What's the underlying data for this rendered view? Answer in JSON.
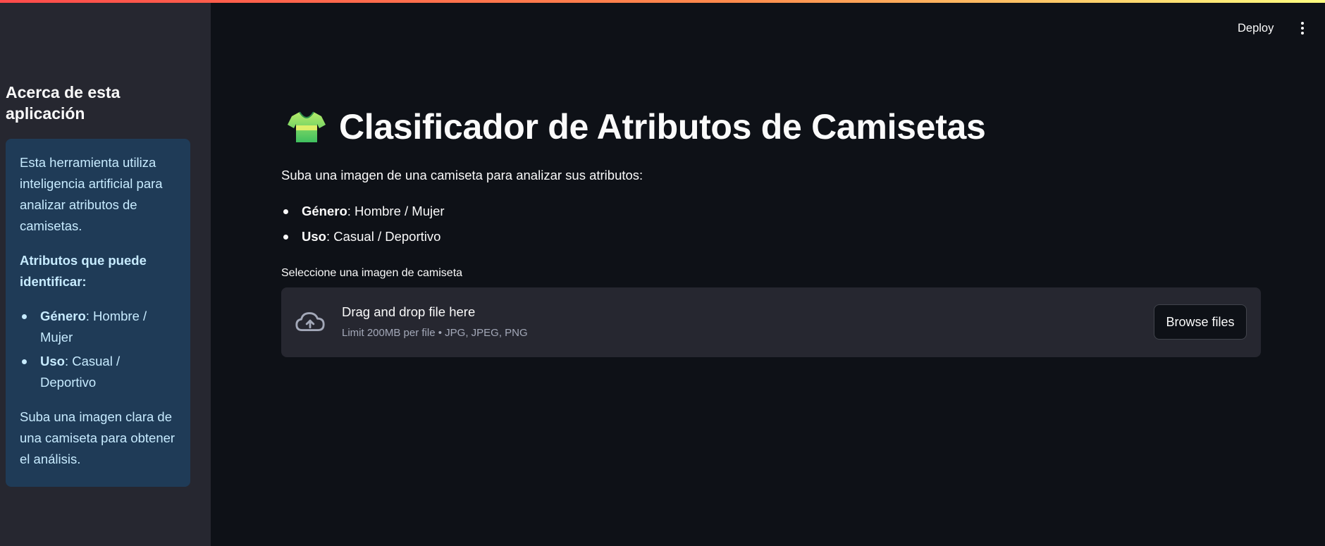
{
  "header": {
    "deploy_label": "Deploy",
    "menu_icon": "vertical-ellipsis-icon"
  },
  "sidebar": {
    "heading": "Acerca de esta aplicación",
    "info": {
      "intro": "Esta herramienta utiliza inteligencia artificial para analizar atributos de camisetas.",
      "attributes_heading": "Atributos que puede identificar:",
      "items": [
        {
          "term": "Género",
          "value": ": Hombre / Mujer"
        },
        {
          "term": "Uso",
          "value": ": Casual / Deportivo"
        }
      ],
      "footer": "Suba una imagen clara de una camiseta para obtener el análisis."
    }
  },
  "main": {
    "title_icon": "t-shirt-icon",
    "title": "Clasificador de Atributos de Camisetas",
    "intro": "Suba una imagen de una camiseta para analizar sus atributos:",
    "attributes": [
      {
        "term": "Género",
        "value": ": Hombre / Mujer"
      },
      {
        "term": "Uso",
        "value": ": Casual / Deportivo"
      }
    ],
    "uploader": {
      "label": "Seleccione una imagen de camiseta",
      "icon": "cloud-upload-icon",
      "drop_text": "Drag and drop file here",
      "limit_text": "Limit 200MB per file • JPG, JPEG, PNG",
      "browse_label": "Browse files"
    }
  },
  "colors": {
    "background": "#0e1117",
    "sidebar_bg": "#262730",
    "info_box_bg": "#1f3b57",
    "info_text": "#c7ebff",
    "accent_gradient": [
      "#ff4b4b",
      "#fffd80"
    ]
  }
}
